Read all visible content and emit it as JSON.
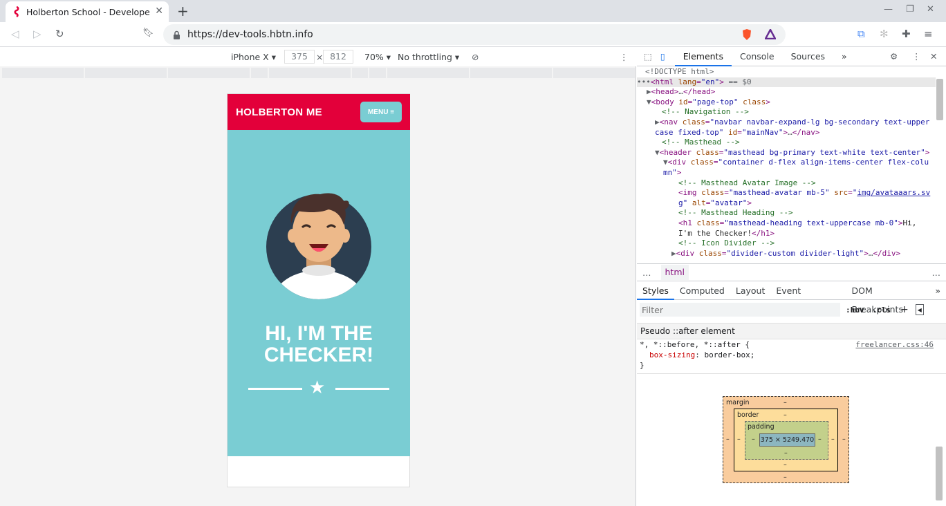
{
  "browser": {
    "tab_title": "Holberton School - Developer",
    "tab_close": "✕",
    "new_tab": "+",
    "url": "https://dev-tools.hbtn.info"
  },
  "device_toolbar": {
    "device": "iPhone X",
    "width": "375",
    "times": "×",
    "height": "812",
    "zoom": "70%",
    "throttling": "No throttling"
  },
  "page": {
    "brand": "HOLBERTON ME",
    "menu_label": "MENU ≡",
    "heading_line1": "HI, I'M THE",
    "heading_line2": "CHECKER!"
  },
  "devtools": {
    "tabs": [
      "Elements",
      "Console",
      "Sources"
    ],
    "more_tabs": "»",
    "elements_lines": [
      {
        "html": "<span class='g'>&lt;!DOCTYPE html&gt;</span>",
        "indent": 12
      },
      {
        "html": "<span class='g'>•••</span><span class='t'>&lt;html</span> <span class='a'>lang</span>=<span class='v'>\"en\"</span><span class='t'>&gt;</span> <span class='g'>== $0</span>",
        "indent": 0,
        "sel": true
      },
      {
        "html": "<span class='g'>▶</span><span class='t'>&lt;head&gt;</span><span class='g'>…</span><span class='t'>&lt;/head&gt;</span>",
        "indent": 14
      },
      {
        "html": "<span class='g'>▼</span><span class='t'>&lt;body</span> <span class='a'>id</span>=<span class='v'>\"page-top\"</span> <span class='a'>class</span><span class='t'>&gt;</span>",
        "indent": 14
      },
      {
        "html": "<span class='c'>&lt;!-- Navigation --&gt;</span>",
        "indent": 36
      },
      {
        "html": "<span class='g'>▶</span><span class='t'>&lt;nav</span> <span class='a'>class</span>=<span class='v'>\"navbar navbar-expand-lg bg-secondary text-upper</span>",
        "indent": 26
      },
      {
        "html": "<span class='v'>case fixed-top\"</span> <span class='a'>id</span>=<span class='v'>\"mainNav\"</span><span class='t'>&gt;</span><span class='g'>…</span><span class='t'>&lt;/nav&gt;</span>",
        "indent": 26
      },
      {
        "html": "<span class='c'>&lt;!-- Masthead --&gt;</span>",
        "indent": 36
      },
      {
        "html": "<span class='g'>▼</span><span class='t'>&lt;header</span> <span class='a'>class</span>=<span class='v'>\"masthead bg-primary text-white text-center\"</span><span class='t'>&gt;</span>",
        "indent": 26
      },
      {
        "html": "<span class='g'>▼</span><span class='t'>&lt;div</span> <span class='a'>class</span>=<span class='v'>\"container d-flex align-items-center flex-colu</span>",
        "indent": 38
      },
      {
        "html": "<span class='v'>mn\"</span><span class='t'>&gt;</span>",
        "indent": 38
      },
      {
        "html": "<span class='c'>&lt;!-- Masthead Avatar Image --&gt;</span>",
        "indent": 60
      },
      {
        "html": "<span class='t'>&lt;img</span> <span class='a'>class</span>=<span class='v'>\"masthead-avatar mb-5\"</span> <span class='a'>src</span>=<span class='v'>\"</span><span class='u'>img/avataaars.sv</span>",
        "indent": 60
      },
      {
        "html": "<span class='u'>g</span><span class='v'>\"</span> <span class='a'>alt</span>=<span class='v'>\"avatar\"</span><span class='t'>&gt;</span>",
        "indent": 60
      },
      {
        "html": "<span class='c'>&lt;!-- Masthead Heading --&gt;</span>",
        "indent": 60
      },
      {
        "html": "<span class='t'>&lt;h1</span> <span class='a'>class</span>=<span class='v'>\"masthead-heading text-uppercase mb-0\"</span><span class='t'>&gt;</span><span style='color:#222'>Hi,</span>",
        "indent": 60
      },
      {
        "html": "<span style='color:#222'>I'm the Checker!</span><span class='t'>&lt;/h1&gt;</span>",
        "indent": 60
      },
      {
        "html": "<span class='c'>&lt;!-- Icon Divider --&gt;</span>",
        "indent": 60
      },
      {
        "html": "<span class='g'>▶</span><span class='t'>&lt;div</span> <span class='a'>class</span>=<span class='v'>\"divider-custom divider-light\"</span><span class='t'>&gt;</span><span class='g'>…</span><span class='t'>&lt;/div&gt;</span>",
        "indent": 50
      }
    ],
    "breadcrumb_dots": "…",
    "breadcrumb": "html",
    "sub_tabs": [
      "Styles",
      "Computed",
      "Layout",
      "Event Listeners",
      "DOM Breakpoints"
    ],
    "filter_placeholder": "Filter",
    "hov": ":hov",
    "cls": ".cls",
    "pseudo_label": "Pseudo ::after element",
    "rule_selector": "*, *::before, *::after {",
    "rule_source": "freelancer.css:46",
    "rule_prop": "box-sizing",
    "rule_val": "border-box;",
    "rule_close": "}",
    "box_model": {
      "margin": "margin",
      "border": "border",
      "padding": "padding",
      "content": "375 × 5249.470",
      "dash": "–"
    }
  }
}
